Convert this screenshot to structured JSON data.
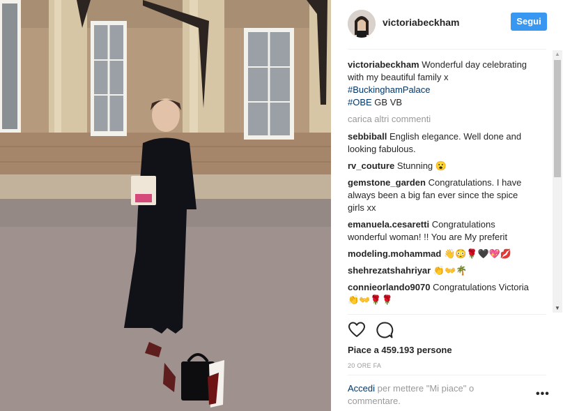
{
  "header": {
    "username": "victoriabeckham",
    "follow_label": "Segui"
  },
  "caption": {
    "author": "victoriabeckham",
    "text": "Wonderful day celebrating with my beautiful family x",
    "hashtag1": "#BuckinghamPalace",
    "hashtag2": "#OBE",
    "suffix": " GB VB"
  },
  "load_more_label": "carica altri commenti",
  "comments": [
    {
      "author": "sebbiball",
      "text": "English elegance. Well done and looking fabulous."
    },
    {
      "author": "rv_couture",
      "text": "Stunning 😮"
    },
    {
      "author": "gemstone_garden",
      "text": "Congratulations. I have always been a big fan ever since the spice girls xx"
    },
    {
      "author": "emanuela.cesaretti",
      "text": "Congratulations wonderful woman! !! You are My preferit"
    },
    {
      "author": "modeling.mohammad",
      "text": "👋😳🌹🖤💖💋"
    },
    {
      "author": "shehrezatshahriyar",
      "text": "👏👐🌴"
    },
    {
      "author": "connieorlando9070",
      "text": "Congratulations Victoria 👏👐🌹🌹"
    }
  ],
  "likes_text": "Piace a 459.193 persone",
  "timestamp": "20 ORE FA",
  "login_prompt": {
    "link": "Accedi",
    "text": " per mettere \"Mi piace\" o commentare."
  },
  "more_options_label": "•••",
  "icons": {
    "like": "heart-icon",
    "comment": "comment-icon",
    "more": "more-options-icon"
  },
  "colors": {
    "accent": "#3897f0",
    "link": "#003569",
    "muted": "#999999",
    "text": "#262626"
  }
}
